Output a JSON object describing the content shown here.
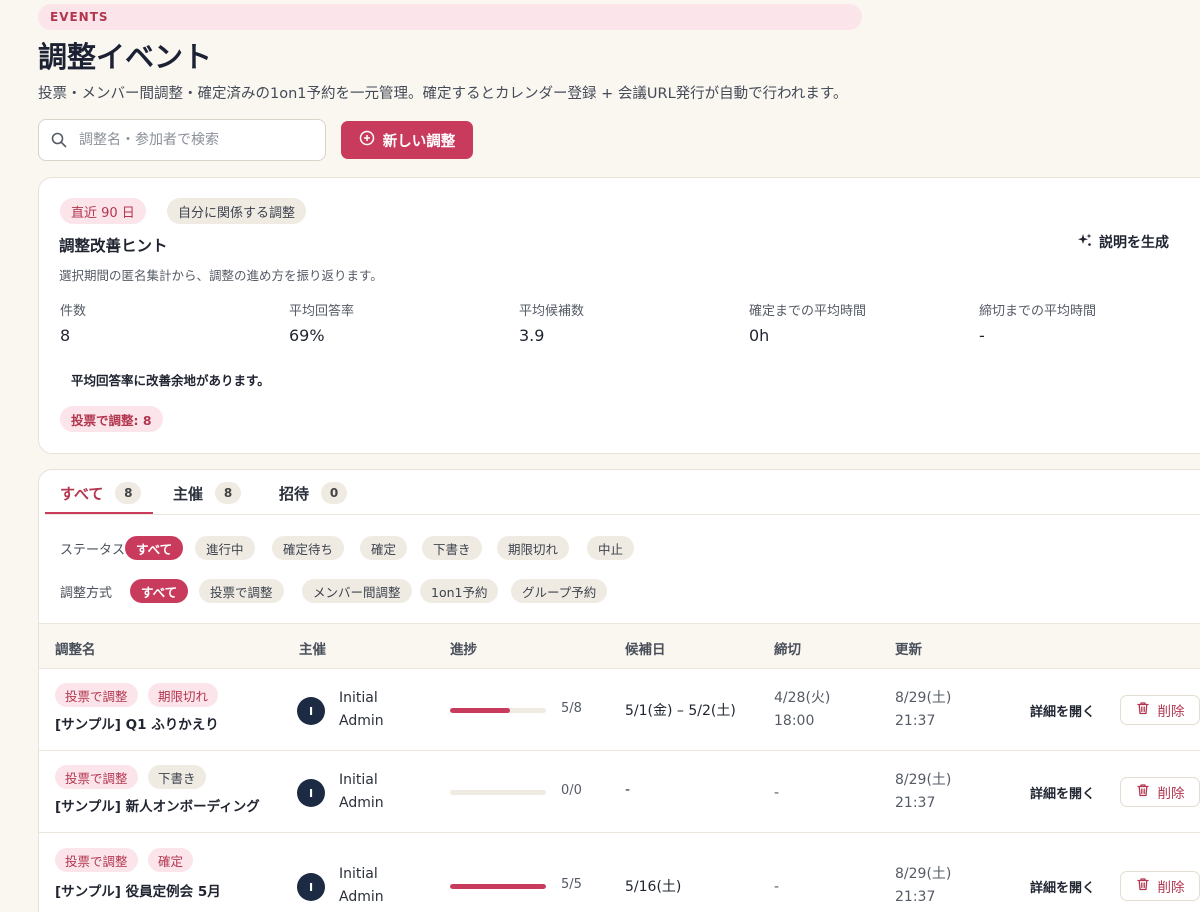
{
  "header": {
    "eyebrow": "EVENTS",
    "title": "調整イベント",
    "description": "投票・メンバー間調整・確定済みの1on1予約を一元管理。確定するとカレンダー登録 + 会議URL発行が自動で行われます。"
  },
  "search": {
    "placeholder": "調整名・参加者で検索"
  },
  "new_button": {
    "label": "新しい調整"
  },
  "insights": {
    "chips": [
      "直近 90 日",
      "自分に関係する調整"
    ],
    "title": "調整改善ヒント",
    "subtitle": "選択期間の匿名集計から、調整の進め方を振り返ります。",
    "generate_label": "説明を生成",
    "stats": [
      {
        "label": "件数",
        "value": "8"
      },
      {
        "label": "平均回答率",
        "value": "69%"
      },
      {
        "label": "平均候補数",
        "value": "3.9"
      },
      {
        "label": "確定までの平均時間",
        "value": "0h"
      },
      {
        "label": "締切までの平均時間",
        "value": "-"
      }
    ],
    "hint": "平均回答率に改善余地があります。",
    "method_chip": "投票で調整: 8"
  },
  "tabs": [
    {
      "label": "すべて",
      "count": "8"
    },
    {
      "label": "主催",
      "count": "8"
    },
    {
      "label": "招待",
      "count": "0"
    }
  ],
  "filters": {
    "status_label": "ステータス",
    "status_options": [
      "すべて",
      "進行中",
      "確定待ち",
      "確定",
      "下書き",
      "期限切れ",
      "中止"
    ],
    "method_label": "調整方式",
    "method_options": [
      "すべて",
      "投票で調整",
      "メンバー間調整",
      "1on1予約",
      "グループ予約"
    ]
  },
  "table": {
    "headers": [
      "調整名",
      "主催",
      "進捗",
      "候補日",
      "締切",
      "更新"
    ],
    "open_label": "詳細を開く",
    "delete_label": "削除",
    "rows": [
      {
        "tags": [
          "投票で調整",
          "期限切れ"
        ],
        "title": "[サンプル] Q1 ふりかえり",
        "avatar": "I",
        "owner_line1": "Initial",
        "owner_line2": "Admin",
        "progress": 0.625,
        "progress_text": "5/8",
        "candidates": "5/1(金) – 5/2(土)",
        "deadline_line1": "4/28(火)",
        "deadline_line2": "18:00",
        "updated_line1": "8/29(土)",
        "updated_line2": "21:37"
      },
      {
        "tags": [
          "投票で調整",
          "下書き"
        ],
        "title": "[サンプル] 新人オンボーディング",
        "avatar": "I",
        "owner_line1": "Initial",
        "owner_line2": "Admin",
        "progress": 0,
        "progress_text": "0/0",
        "candidates": "-",
        "deadline_line1": "-",
        "deadline_line2": "",
        "updated_line1": "8/29(土)",
        "updated_line2": "21:37"
      },
      {
        "tags": [
          "投票で調整",
          "確定"
        ],
        "title": "[サンプル] 役員定例会 5月",
        "avatar": "I",
        "owner_line1": "Initial",
        "owner_line2": "Admin",
        "progress": 1,
        "progress_text": "5/5",
        "candidates": "5/16(土)",
        "deadline_line1": "-",
        "deadline_line2": "",
        "updated_line1": "8/29(土)",
        "updated_line2": "21:37"
      }
    ]
  },
  "colors": {
    "accent": "#c93b5c",
    "pink_bg": "#fbe5ea",
    "beige_chip": "#efebe3",
    "page_bg": "#faf7f1"
  }
}
